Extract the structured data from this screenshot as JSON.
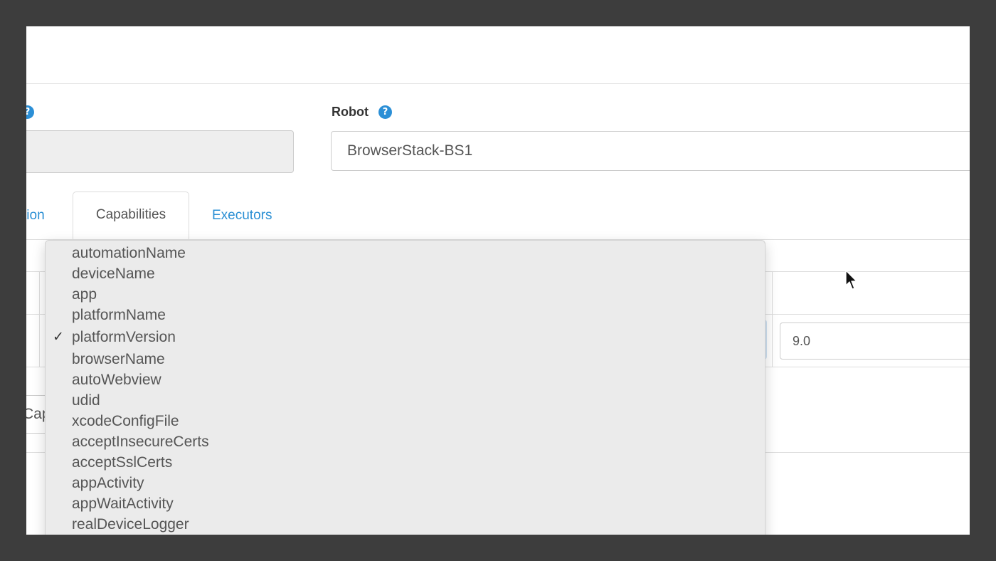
{
  "form": {
    "robot_label": "Robot",
    "robot_value": "BrowserStack-BS1",
    "help_icon_glyph": "?"
  },
  "tabs": [
    {
      "label": "tion",
      "active": false
    },
    {
      "label": "Capabilities",
      "active": true
    },
    {
      "label": "Executors",
      "active": false
    }
  ],
  "capabilities": {
    "selected_value": "9.0",
    "add_button_label": "Capability"
  },
  "dropdown": {
    "check_glyph": "✓",
    "selected_index": 4,
    "options": [
      "automationName",
      "deviceName",
      "app",
      "platformName",
      "platformVersion",
      "browserName",
      "autoWebview",
      "udid",
      "xcodeConfigFile",
      "acceptInsecureCerts",
      "acceptSslCerts",
      "appActivity",
      "appWaitActivity",
      "realDeviceLogger"
    ]
  },
  "colors": {
    "link": "#2a8fd4",
    "help_icon": "#2b8fd6",
    "frame": "#3d3d3d"
  }
}
